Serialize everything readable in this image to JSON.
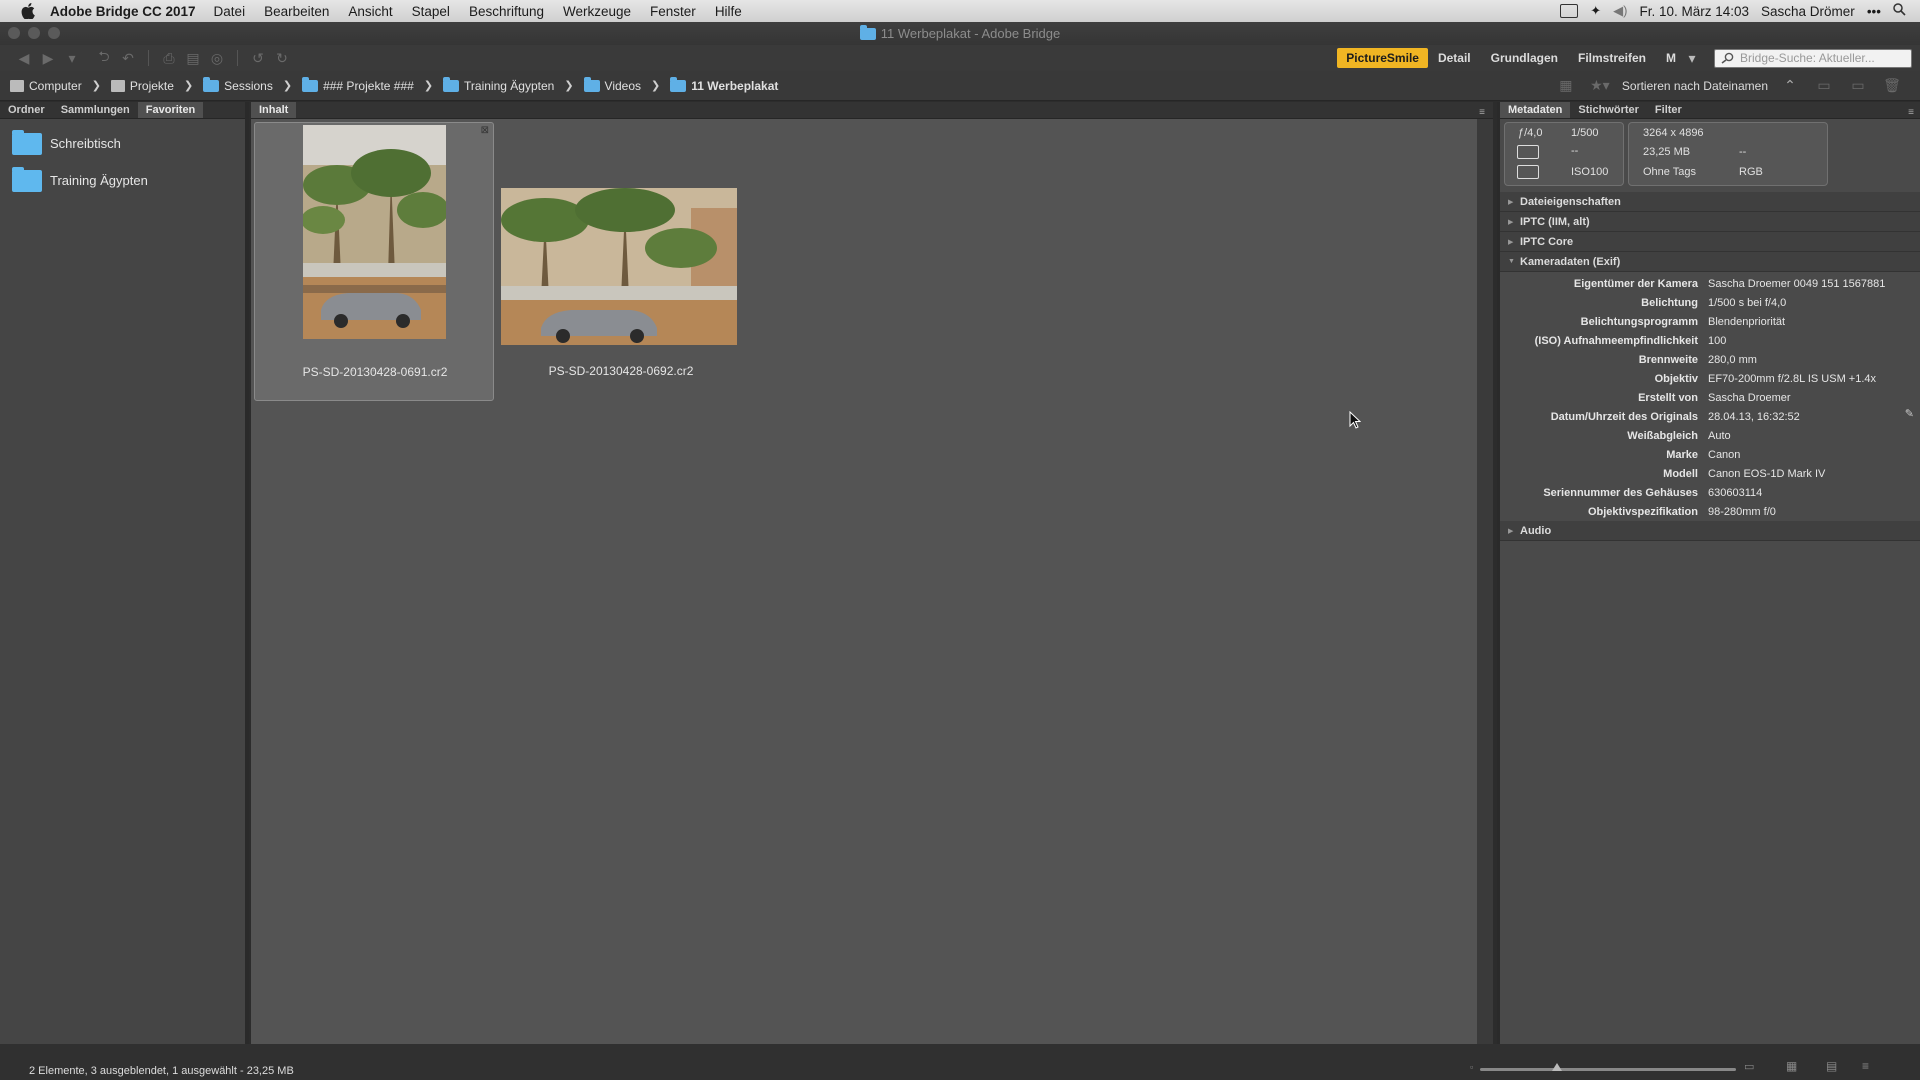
{
  "menubar": {
    "app_name": "Adobe Bridge CC 2017",
    "items": [
      "Datei",
      "Bearbeiten",
      "Ansicht",
      "Stapel",
      "Beschriftung",
      "Werkzeuge",
      "Fenster",
      "Hilfe"
    ],
    "datetime": "Fr. 10. März  14:03",
    "user": "Sascha Drömer"
  },
  "window": {
    "title": "11 Werbeplakat - Adobe Bridge"
  },
  "toolbar": {
    "workspaces": [
      "PictureSmile",
      "Detail",
      "Grundlagen",
      "Filmstreifen",
      "M"
    ],
    "active_workspace": "PictureSmile",
    "search_placeholder": "Bridge-Suche: Aktueller..."
  },
  "pathbar": {
    "crumbs": [
      "Computer",
      "Projekte",
      "Sessions",
      "### Projekte ###",
      "Training Ägypten",
      "Videos",
      "11 Werbeplakat"
    ],
    "sort_label": "Sortieren nach Dateinamen"
  },
  "left_panel": {
    "tabs": [
      "Ordner",
      "Sammlungen",
      "Favoriten"
    ],
    "active_tab": "Favoriten",
    "favorites": [
      "Schreibtisch",
      "Training Ägypten"
    ]
  },
  "content": {
    "tab": "Inhalt",
    "items": [
      {
        "filename": "PS-SD-20130428-0691.cr2",
        "selected": true,
        "orientation": "portrait"
      },
      {
        "filename": "PS-SD-20130428-0692.cr2",
        "selected": false,
        "orientation": "landscape"
      }
    ]
  },
  "right_panel": {
    "tabs": [
      "Metadaten",
      "Stichwörter",
      "Filter"
    ],
    "active_tab": "Metadaten",
    "camera_box": {
      "aperture": "ƒ/4,0",
      "shutter": "1/500",
      "metering": "--",
      "iso": "100",
      "dimensions": "3264 x 4896",
      "filesize": "23,25 MB",
      "size_extra": "--",
      "tags": "Ohne Tags",
      "colormode": "RGB"
    },
    "sections": [
      "Dateieigenschaften",
      "IPTC (IIM, alt)",
      "IPTC Core",
      "Kameradaten (Exif)",
      "Audio"
    ],
    "exif": [
      {
        "key": "Eigentümer der Kamera",
        "value": "Sascha Droemer 0049 151 1567881"
      },
      {
        "key": "Belichtung",
        "value": "1/500 s bei f/4,0"
      },
      {
        "key": "Belichtungsprogramm",
        "value": "Blendenpriorität"
      },
      {
        "key": "(ISO) Aufnahmeempfindlichkeit",
        "value": "100"
      },
      {
        "key": "Brennweite",
        "value": "280,0 mm"
      },
      {
        "key": "Objektiv",
        "value": "EF70-200mm f/2.8L IS USM +1.4x"
      },
      {
        "key": "Erstellt von",
        "value": "Sascha Droemer"
      },
      {
        "key": "Datum/Uhrzeit des Originals",
        "value": "28.04.13, 16:32:52"
      },
      {
        "key": "Weißabgleich",
        "value": "Auto"
      },
      {
        "key": "Marke",
        "value": "Canon"
      },
      {
        "key": "Modell",
        "value": "Canon EOS-1D Mark IV"
      },
      {
        "key": "Seriennummer des Gehäuses",
        "value": "630603114"
      },
      {
        "key": "Objektivspezifikation",
        "value": "98-280mm f/0"
      }
    ]
  },
  "statusbar": {
    "text": "2 Elemente, 3 ausgeblendet, 1 ausgewählt - 23,25 MB",
    "zoom_level": 0.3
  },
  "colors": {
    "accent": "#f0b523",
    "folder": "#5fb0e6"
  }
}
